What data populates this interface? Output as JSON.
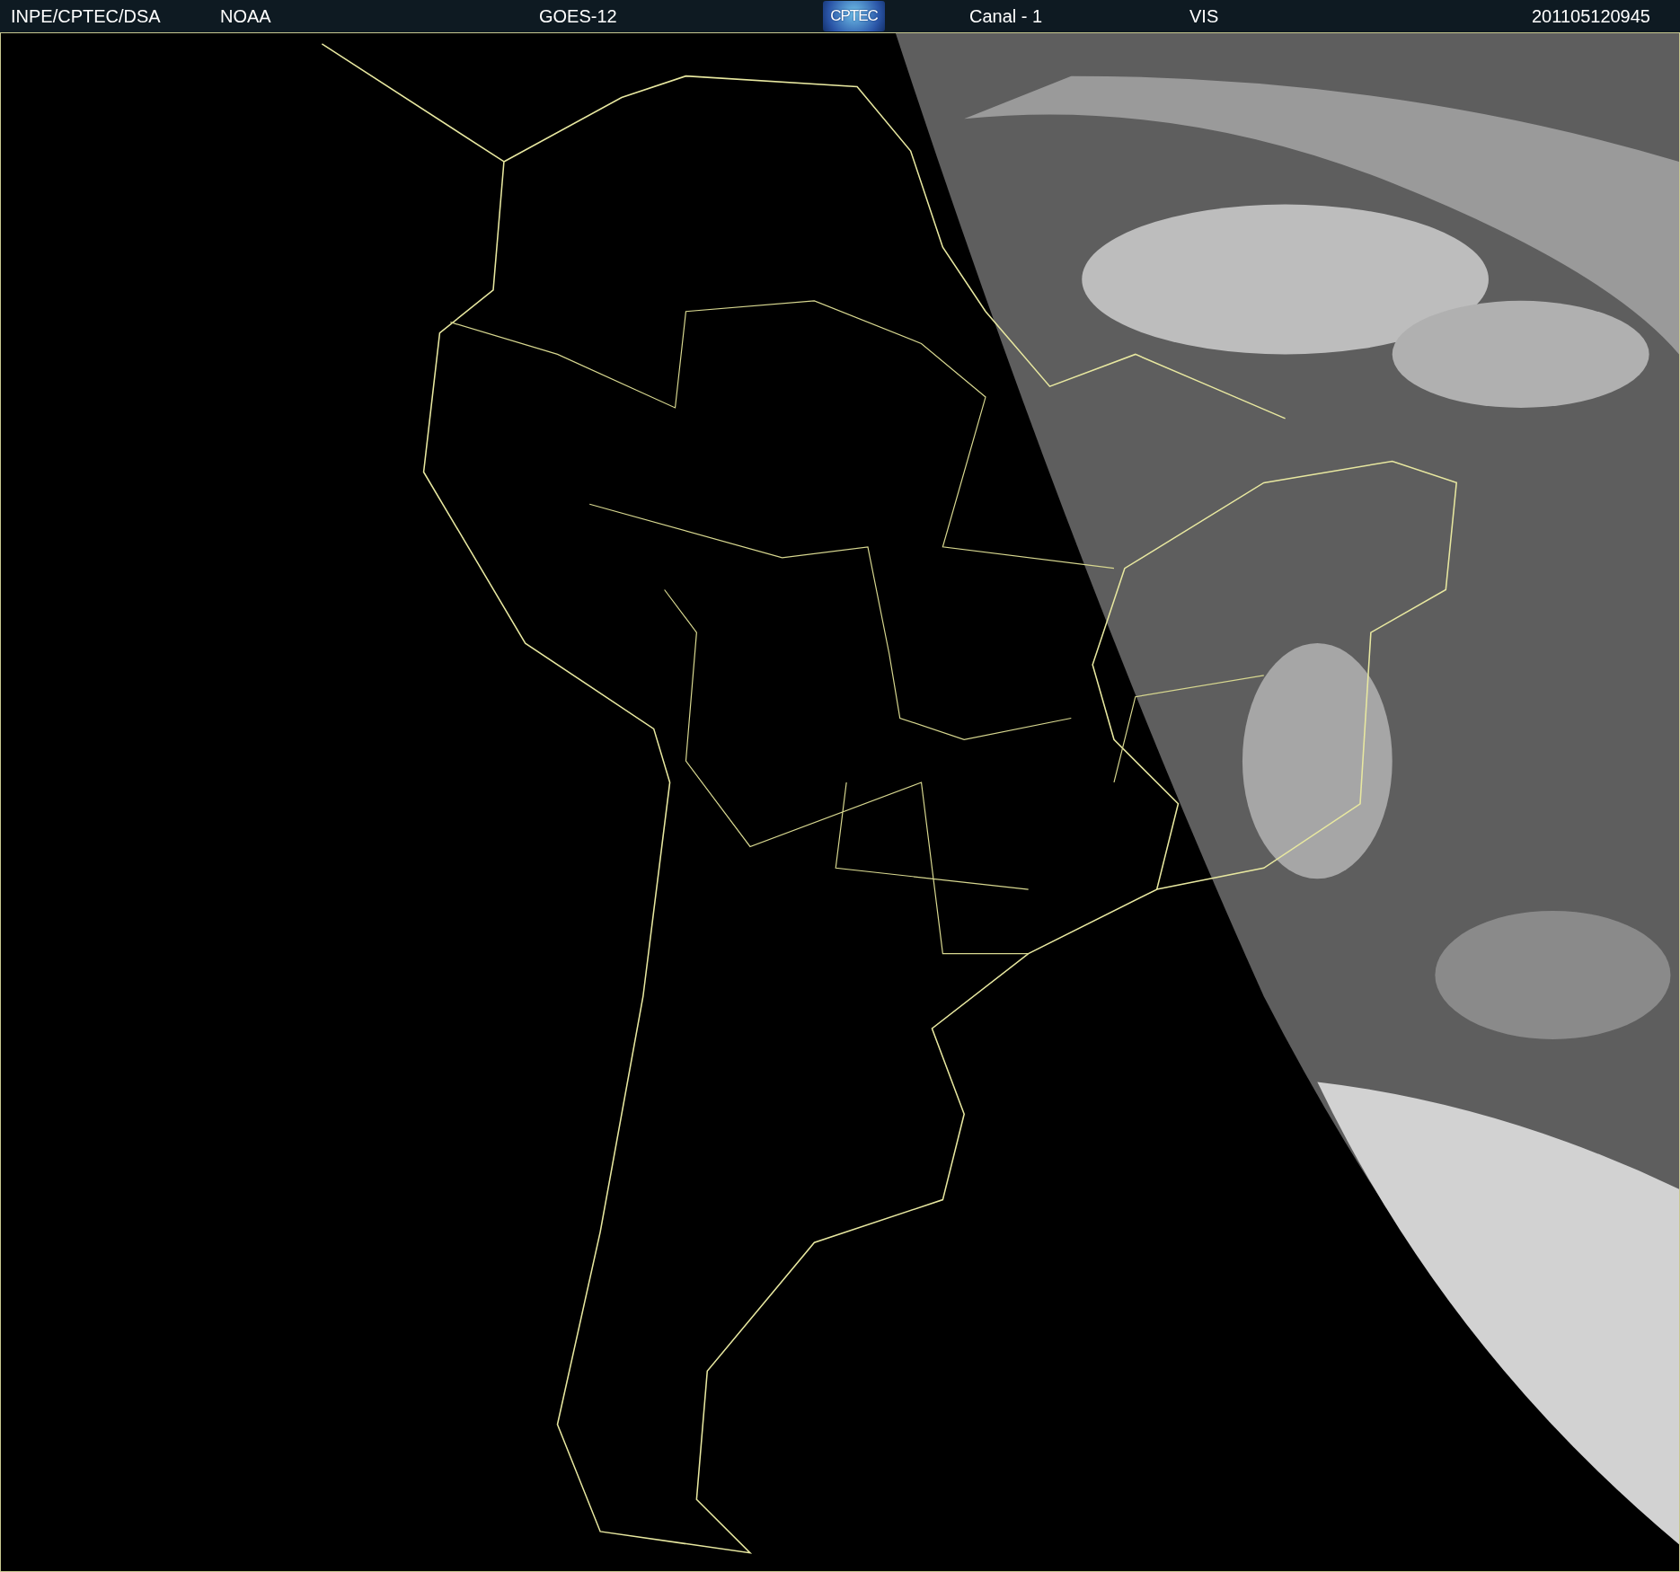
{
  "header": {
    "texts": [
      {
        "kind": "text",
        "text": "INPE/CPTEC/DSA"
      },
      {
        "kind": "text",
        "text": "NOAA"
      },
      {
        "kind": "text",
        "text": "GOES-12"
      },
      {
        "kind": "logo",
        "text": "CPTEC"
      },
      {
        "kind": "text",
        "text": "Canal - 1"
      },
      {
        "kind": "text",
        "text": "VIS"
      },
      {
        "kind": "text",
        "text": "201105120945"
      }
    ]
  }
}
